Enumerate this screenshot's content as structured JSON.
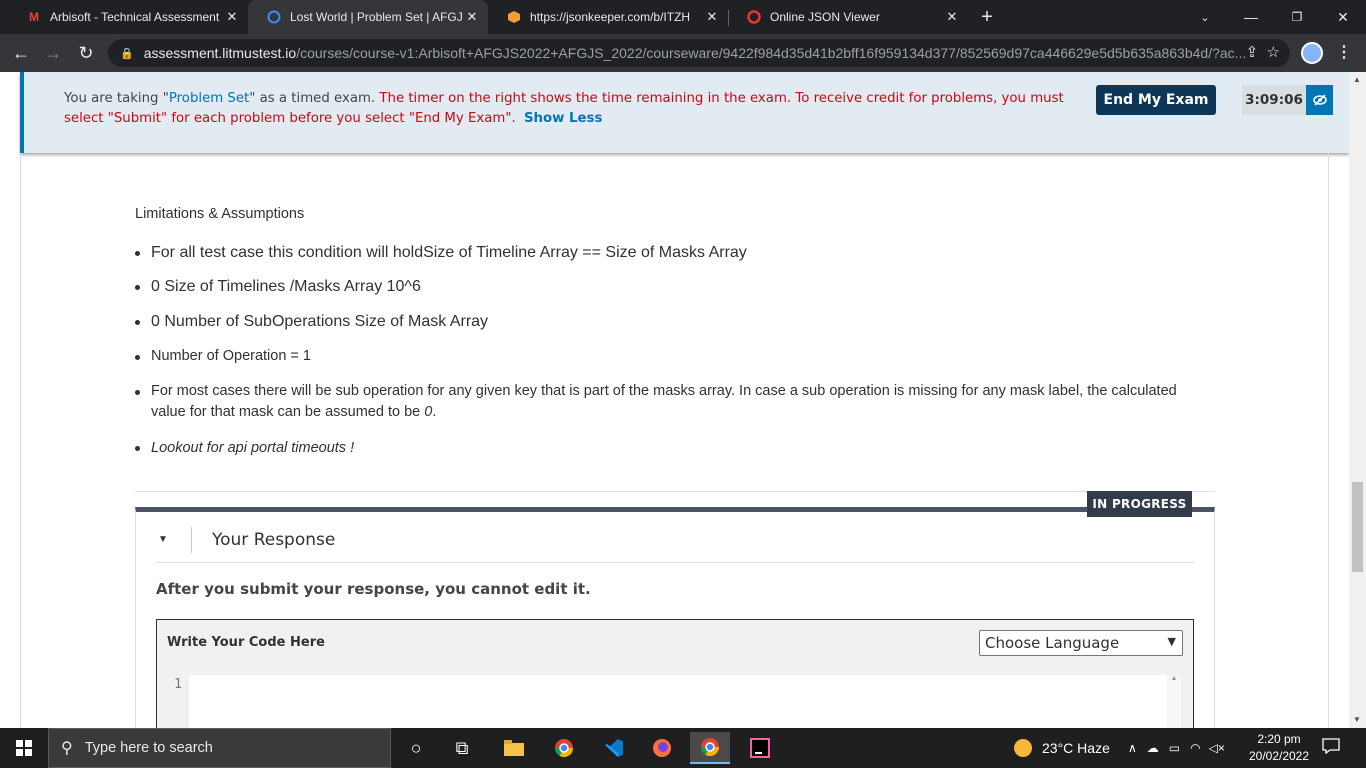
{
  "browser": {
    "tabs": [
      {
        "title": "Arbisoft - Technical Assessment -",
        "icon": "gmail-icon",
        "active": false
      },
      {
        "title": "Lost World | Problem Set | AFGJS",
        "icon": "edx-icon",
        "active": true
      },
      {
        "title": "https://jsonkeeper.com/b/ITZH",
        "icon": "jsonkeeper-icon",
        "active": false
      },
      {
        "title": "Online JSON Viewer",
        "icon": "opera-icon",
        "active": false
      }
    ],
    "url_host": "assessment.litmustest.io",
    "url_path": "/courses/course-v1:Arbisoft+AFGJS2022+AFGJS_2022/courseware/9422f984d35d41b2bff16f959134d377/852569d97ca446629e5d5b635a863b4d/?ac..."
  },
  "exam_banner": {
    "part1": "You are taking \"",
    "exam_name": "Problem Set",
    "part2": "\" as a timed exam. ",
    "warning": "The timer on the right shows the time remaining in the exam. To receive credit for problems, you must select \"Submit\" for each problem before you select \"End My Exam\".",
    "show_less": "Show Less",
    "end_button": "End My Exam",
    "timer": "3:09:06"
  },
  "limitations": {
    "title": "Limitations & Assumptions",
    "items": [
      "For all test case this condition will holdSize of Timeline Array == Size of Masks Array",
      "0  Size of Timelines /Masks Array  10^6",
      "0  Number of SubOperations  Size of Mask Array",
      "Number of Operation = 1",
      "For most cases there will be sub operation for any given key that is part of the masks array. In case a sub operation is missing for any mask label, the calculated value for that mask can be assumed to be ",
      "Lookout for api portal timeouts !"
    ],
    "zero": "0",
    "period": "."
  },
  "response": {
    "status": "IN PROGRESS",
    "title": "Your Response",
    "note": "After you submit your response, you cannot edit it.",
    "editor_label": "Write Your Code Here",
    "language_select": "Choose Language",
    "line_number": "1"
  },
  "taskbar": {
    "search_placeholder": "Type here to search",
    "weather": "23°C  Haze",
    "time": "2:20 pm",
    "date": "20/02/2022"
  }
}
